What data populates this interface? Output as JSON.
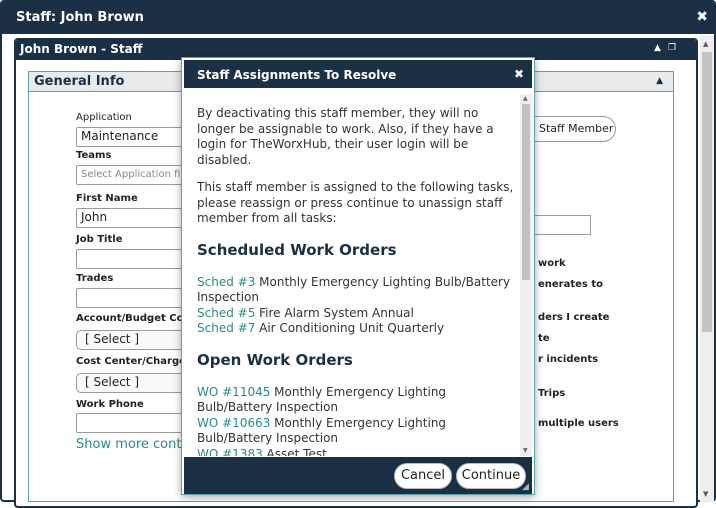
{
  "outer_window": {
    "title": "Staff: John Brown"
  },
  "inner_window": {
    "title": "John Brown - Staff"
  },
  "general_info": {
    "title": "General Info",
    "application": {
      "label": "Application",
      "value": "Maintenance"
    },
    "teams": {
      "label": "Teams",
      "placeholder": "Select Application first"
    },
    "first_name": {
      "label": "First Name",
      "value": "John"
    },
    "job_title": {
      "label": "Job Title",
      "value": ""
    },
    "trades": {
      "label": "Trades",
      "value": ""
    },
    "account_budget_code": {
      "label": "Account/Budget Code",
      "value": "[ Select ]"
    },
    "cost_center": {
      "label": "Cost Center/Charge Code",
      "value": "[ Select ]"
    },
    "work_phone": {
      "label": "Work Phone",
      "value": ""
    },
    "show_more": "Show more contact info",
    "staff_member_button": "Staff Member",
    "right_labels": [
      "work",
      "enerates to",
      "ders I create",
      "te",
      "r incidents",
      "Trips",
      "multiple users"
    ]
  },
  "modal": {
    "title": "Staff Assignments To Resolve",
    "intro_1": "By deactivating this staff member, they will no longer be assignable to work. Also, if they have a login for TheWorxHub, their user login will be disabled.",
    "intro_2": "This staff member is assigned to the following tasks, please reassign or press continue to unassign staff member from all tasks:",
    "scheduled_heading": "Scheduled Work Orders",
    "scheduled": [
      {
        "id": "Sched #3",
        "desc": " Monthly Emergency Lighting Bulb/Battery Inspection"
      },
      {
        "id": "Sched #5",
        "desc": " Fire Alarm System Annual"
      },
      {
        "id": "Sched #7",
        "desc": " Air Conditioning Unit Quarterly"
      }
    ],
    "open_heading": "Open Work Orders",
    "open": [
      {
        "id": "WO #11045",
        "desc": " Monthly Emergency Lighting Bulb/Battery Inspection"
      },
      {
        "id": "WO #10663",
        "desc": " Monthly Emergency Lighting Bulb/Battery Inspection"
      },
      {
        "id": "WO #1383",
        "desc": " Asset Test"
      }
    ],
    "cancel_label": "Cancel",
    "continue_label": "Continue"
  },
  "icons": {
    "outer_close": "close-icon",
    "inner_collapse": "chevron-up-icon",
    "inner_popout": "popout-icon",
    "modal_close": "close-icon",
    "resize_grip": "resize-grip-icon"
  },
  "colors": {
    "titlebar": "#1b2f45",
    "link": "#2a8a8a",
    "panel_border": "#5aa4a8"
  }
}
